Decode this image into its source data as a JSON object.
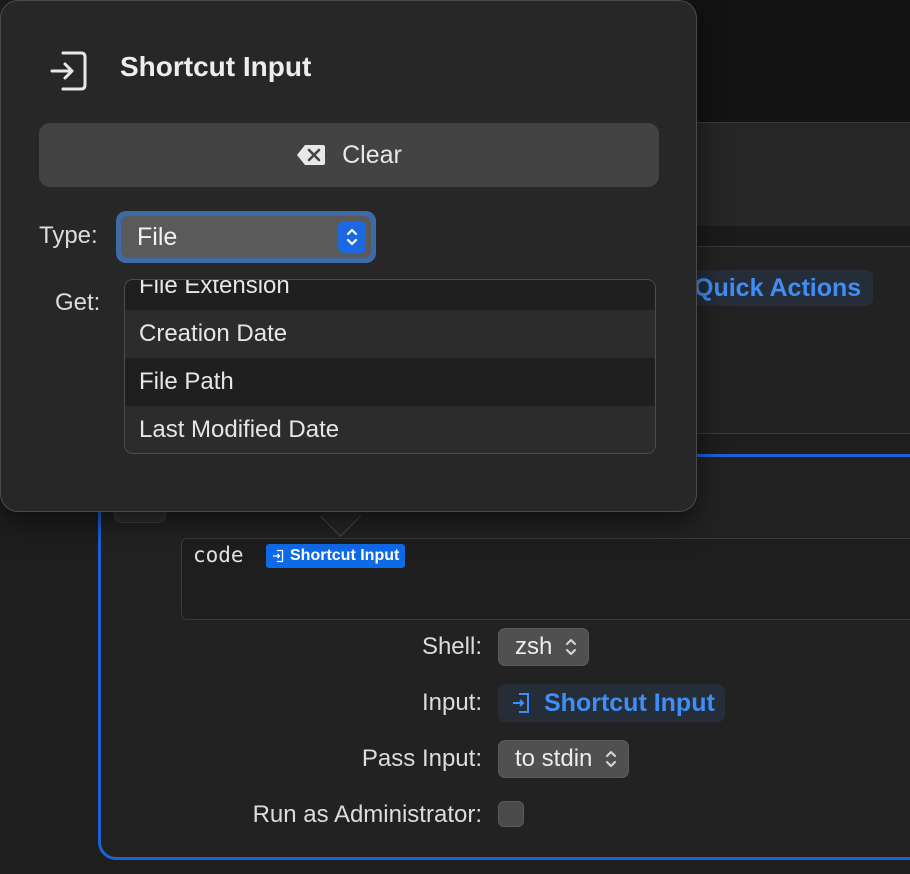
{
  "popover": {
    "title": "Shortcut Input",
    "clear_label": "Clear",
    "type_label": "Type:",
    "type_value": "File",
    "get_label": "Get:",
    "get_options": [
      "File Extension",
      "Creation Date",
      "File Path",
      "Last Modified Date"
    ]
  },
  "background": {
    "quick_actions_label": "Quick Actions"
  },
  "action": {
    "code_text": "code",
    "code_token_label": "Shortcut Input",
    "shell_label": "Shell:",
    "shell_value": "zsh",
    "input_label": "Input:",
    "input_value": "Shortcut Input",
    "pass_input_label": "Pass Input:",
    "pass_input_value": "to stdin",
    "run_as_admin_label": "Run as Administrator:",
    "run_as_admin_checked": false
  },
  "colors": {
    "accent": "#1a62d6",
    "token_blue": "#3f8ef7",
    "popover_bg": "#272727"
  },
  "icons": {
    "shortcut_input": "arrow-into-box-icon",
    "clear": "delete-left-icon",
    "stepper": "up-down-chevron-icon"
  }
}
